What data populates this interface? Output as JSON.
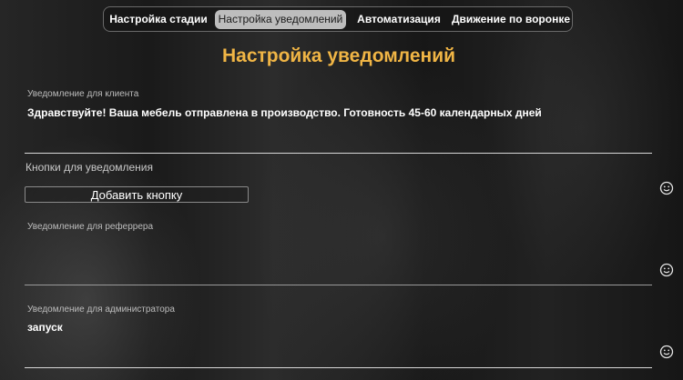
{
  "tabs": [
    {
      "label": "Настройка стадии",
      "active": false
    },
    {
      "label": "Настройка уведомлений",
      "active": true
    },
    {
      "label": "Автоматизация",
      "active": false
    },
    {
      "label": "Движение по воронке",
      "active": false
    }
  ],
  "page": {
    "title": "Настройка уведомлений"
  },
  "client_notification": {
    "label": "Уведомление для клиента",
    "value": "Здравствуйте! Ваша мебель отправлена в производство. Готовность 45-60 календарных дней"
  },
  "buttons_section": {
    "label": "Кнопки для уведомления",
    "add_button_label": "Добавить кнопку"
  },
  "referrer_notification": {
    "label": "Уведомление для реферрера",
    "value": ""
  },
  "admin_notification": {
    "label": "Уведомление для администратора",
    "value": "запуск"
  },
  "icons": {
    "emoji_picker": "smiley-icon"
  },
  "colors": {
    "accent_title": "#f0b545",
    "active_tab_bg": "#bdbdbd"
  }
}
